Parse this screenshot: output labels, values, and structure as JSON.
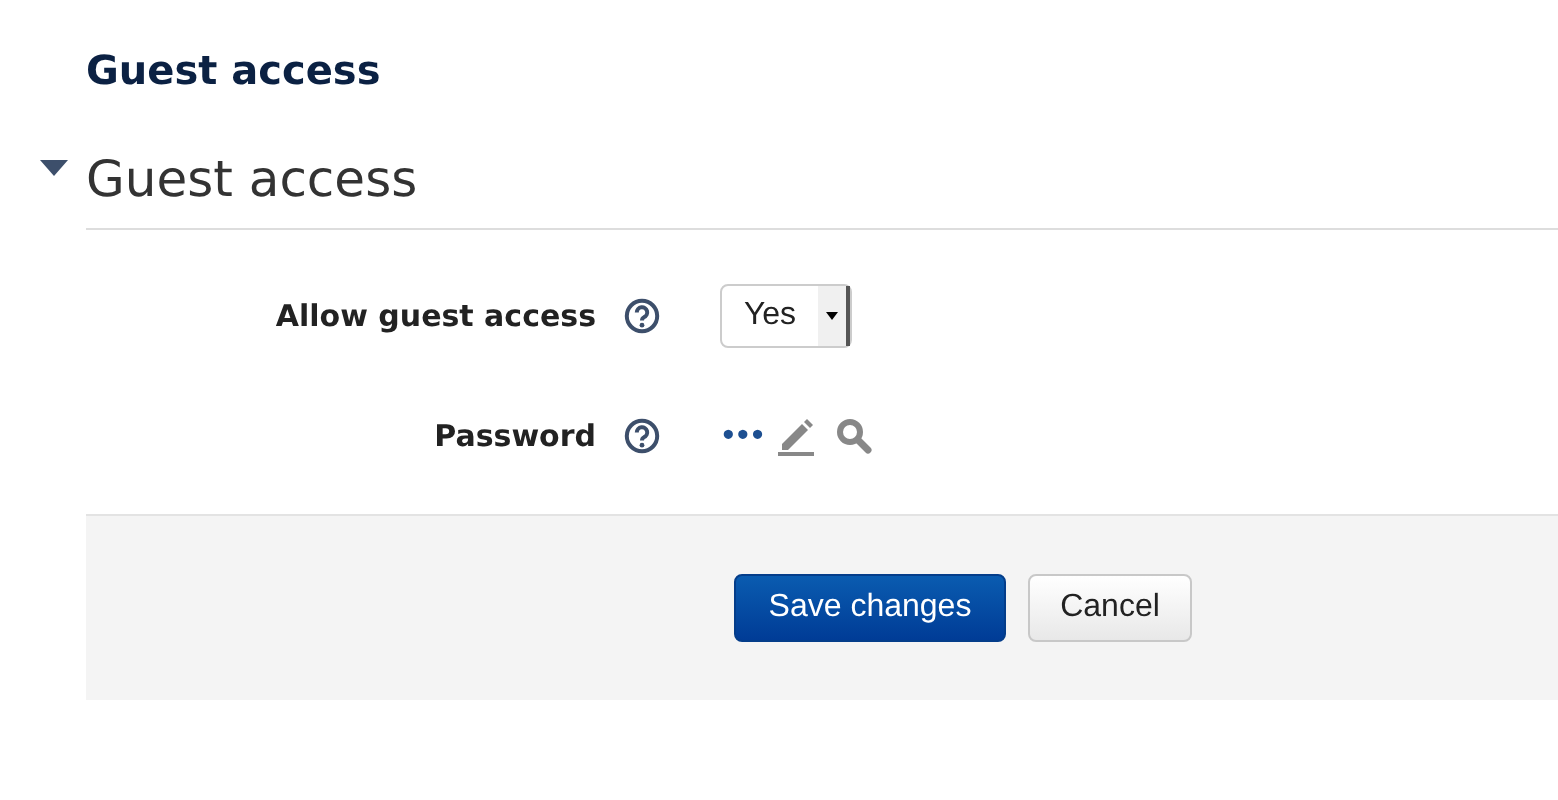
{
  "page_title": "Guest access",
  "section": {
    "title": "Guest access",
    "expanded": true,
    "fields": [
      {
        "kind": "select",
        "label": "Allow guest access",
        "value": "Yes"
      },
      {
        "kind": "password",
        "label": "Password",
        "value": "•••"
      }
    ]
  },
  "buttons": [
    {
      "label": "Save changes",
      "kind": "primary"
    },
    {
      "label": "Cancel",
      "kind": "secondary"
    }
  ]
}
